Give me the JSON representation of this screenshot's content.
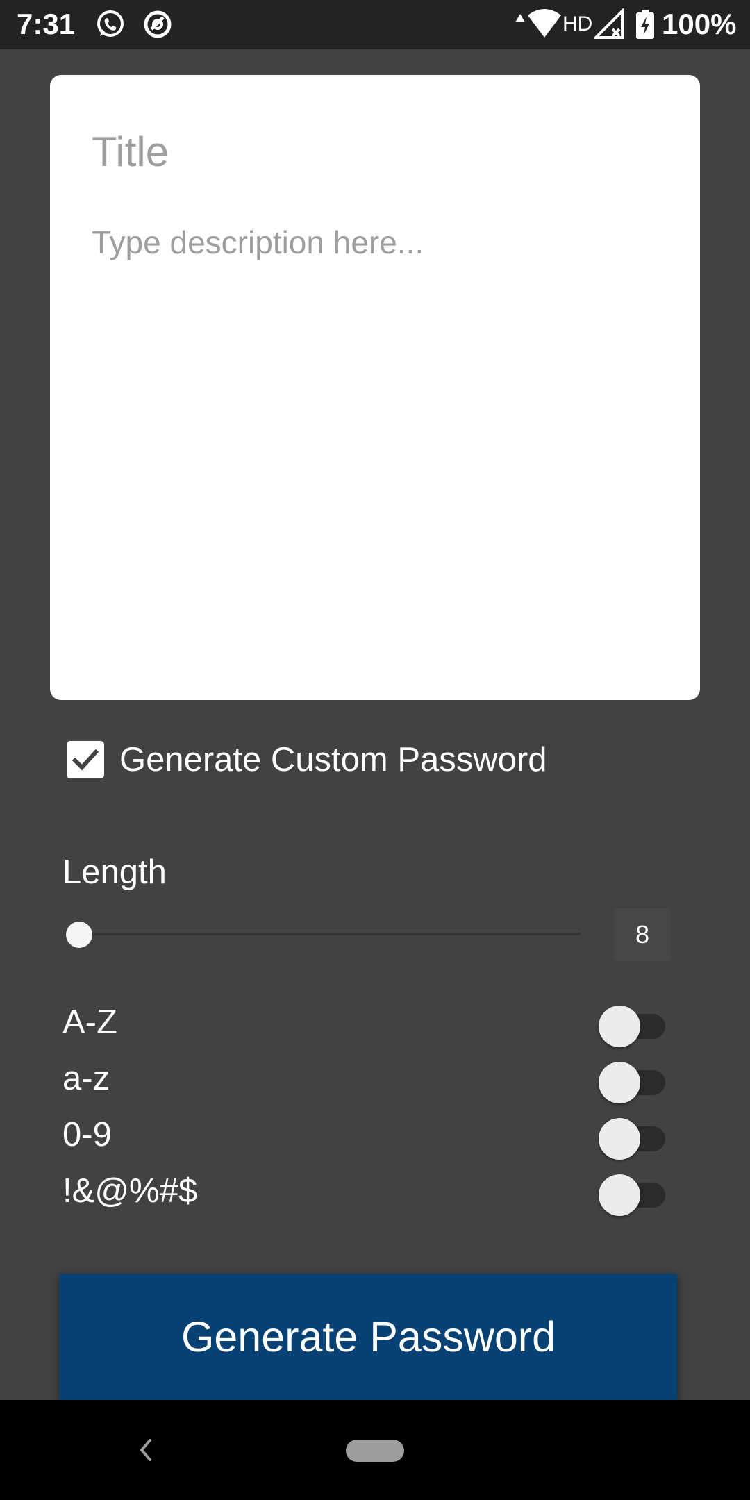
{
  "status_bar": {
    "time": "7:31",
    "network_label": "HD",
    "battery": "100%",
    "icons": [
      "whatsapp-icon",
      "sync-icon",
      "data-arrow-icon",
      "wifi-icon",
      "signal-icon",
      "battery-charging-icon"
    ]
  },
  "note": {
    "title_placeholder": "Title",
    "description_placeholder": "Type description here..."
  },
  "custom_password": {
    "checkbox_label": "Generate Custom Password",
    "checked": true
  },
  "length": {
    "label": "Length",
    "value": "8"
  },
  "options": [
    {
      "label": "A-Z",
      "enabled": false
    },
    {
      "label": "a-z",
      "enabled": false
    },
    {
      "label": "0-9",
      "enabled": false
    },
    {
      "label": "!&@%#$",
      "enabled": false
    }
  ],
  "generate_button": {
    "label": "Generate Password"
  },
  "colors": {
    "background": "#424242",
    "status_bar": "#232323",
    "button": "#084274",
    "card": "#ffffff"
  }
}
